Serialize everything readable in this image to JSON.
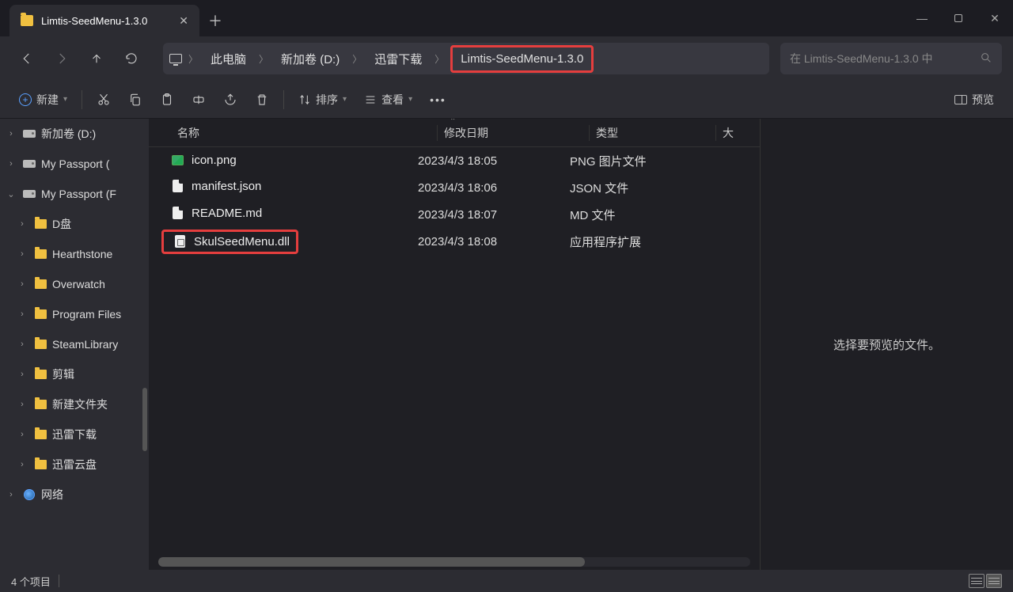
{
  "tab": {
    "title": "Limtis-SeedMenu-1.3.0"
  },
  "breadcrumb": {
    "items": [
      "此电脑",
      "新加卷 (D:)",
      "迅雷下载",
      "Limtis-SeedMenu-1.3.0"
    ]
  },
  "search": {
    "placeholder": "在 Limtis-SeedMenu-1.3.0 中"
  },
  "toolbar": {
    "new": "新建",
    "sort": "排序",
    "view": "查看",
    "preview": "预览"
  },
  "columns": {
    "name": "名称",
    "date": "修改日期",
    "type": "类型",
    "size": "大"
  },
  "sidebar": {
    "items": [
      {
        "label": "新加卷 (D:)",
        "icon": "drive",
        "depth": 0,
        "exp": "›"
      },
      {
        "label": "My Passport (",
        "icon": "drive",
        "depth": 0,
        "exp": "›"
      },
      {
        "label": "My Passport (F",
        "icon": "drive",
        "depth": 0,
        "exp": "⌄"
      },
      {
        "label": "D盘",
        "icon": "folder",
        "depth": 1,
        "exp": "›"
      },
      {
        "label": "Hearthstone",
        "icon": "folder",
        "depth": 1,
        "exp": "›"
      },
      {
        "label": "Overwatch",
        "icon": "folder",
        "depth": 1,
        "exp": "›"
      },
      {
        "label": "Program Files",
        "icon": "folder",
        "depth": 1,
        "exp": "›"
      },
      {
        "label": "SteamLibrary",
        "icon": "folder",
        "depth": 1,
        "exp": "›"
      },
      {
        "label": "剪辑",
        "icon": "folder",
        "depth": 1,
        "exp": "›"
      },
      {
        "label": "新建文件夹",
        "icon": "folder",
        "depth": 1,
        "exp": "›"
      },
      {
        "label": "迅雷下载",
        "icon": "folder",
        "depth": 1,
        "exp": "›"
      },
      {
        "label": "迅雷云盘",
        "icon": "folder",
        "depth": 1,
        "exp": "›"
      },
      {
        "label": "网络",
        "icon": "network",
        "depth": 0,
        "exp": "›"
      }
    ]
  },
  "files": [
    {
      "name": "icon.png",
      "date": "2023/4/3 18:05",
      "type": "PNG 图片文件",
      "icon": "image",
      "hl": false
    },
    {
      "name": "manifest.json",
      "date": "2023/4/3 18:06",
      "type": "JSON 文件",
      "icon": "doc",
      "hl": false
    },
    {
      "name": "README.md",
      "date": "2023/4/3 18:07",
      "type": "MD 文件",
      "icon": "doc",
      "hl": false
    },
    {
      "name": "SkulSeedMenu.dll",
      "date": "2023/4/3 18:08",
      "type": "应用程序扩展",
      "icon": "dll",
      "hl": true
    }
  ],
  "preview": {
    "empty": "选择要预览的文件。"
  },
  "status": {
    "count": "4 个项目"
  }
}
